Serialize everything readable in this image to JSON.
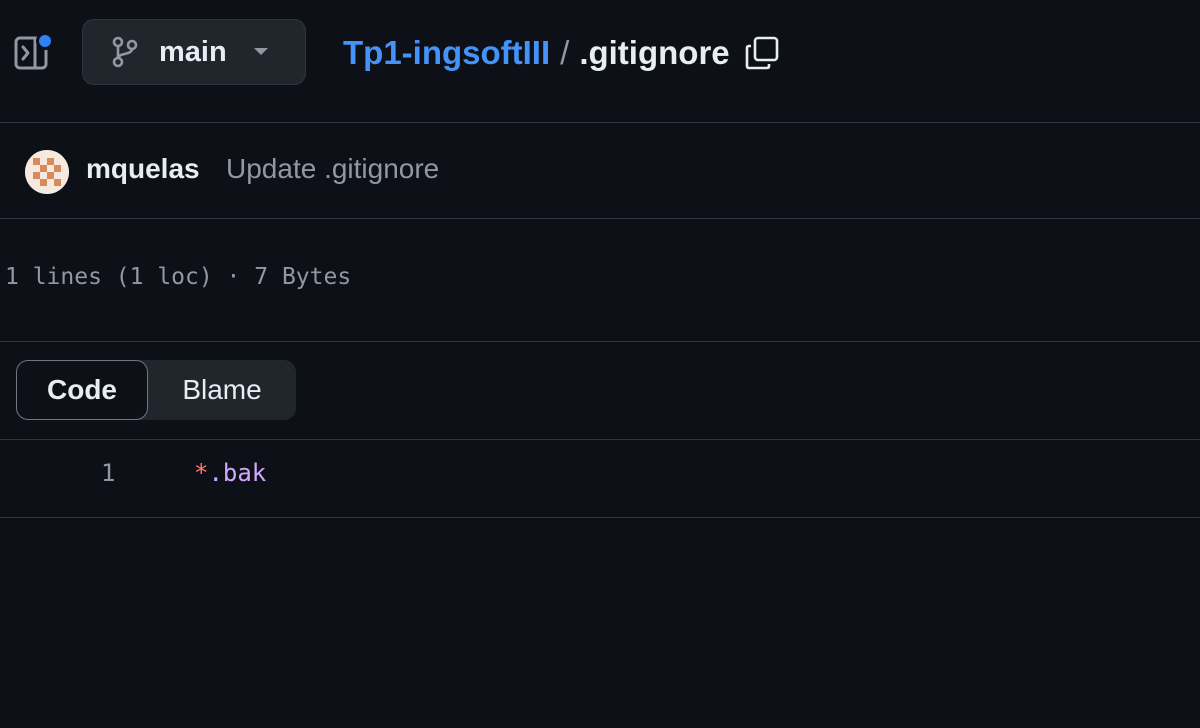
{
  "header": {
    "branch_label": "main",
    "repo_name": "Tp1-ingsoftIII",
    "separator": "/",
    "file_name": ".gitignore"
  },
  "commit": {
    "author": "mquelas",
    "message": "Update .gitignore"
  },
  "file_info": "1 lines (1 loc) · 7 Bytes",
  "view_toggle": {
    "code_label": "Code",
    "blame_label": "Blame",
    "selected": "Code"
  },
  "code": {
    "lines": [
      {
        "number": "1",
        "op": "*",
        "text": ".bak"
      }
    ]
  },
  "colors": {
    "background": "#0d1117",
    "border": "#30363d",
    "link": "#4493f8",
    "notification": "#2f81f7",
    "muted": "#9198a1",
    "token_operator": "#ff7b72",
    "token_text": "#d2a8ff"
  },
  "icons": {
    "sidebar": "sidebar-expand-icon",
    "branch": "git-branch-icon",
    "caret": "triangle-down-icon",
    "copy": "copy-icon"
  }
}
